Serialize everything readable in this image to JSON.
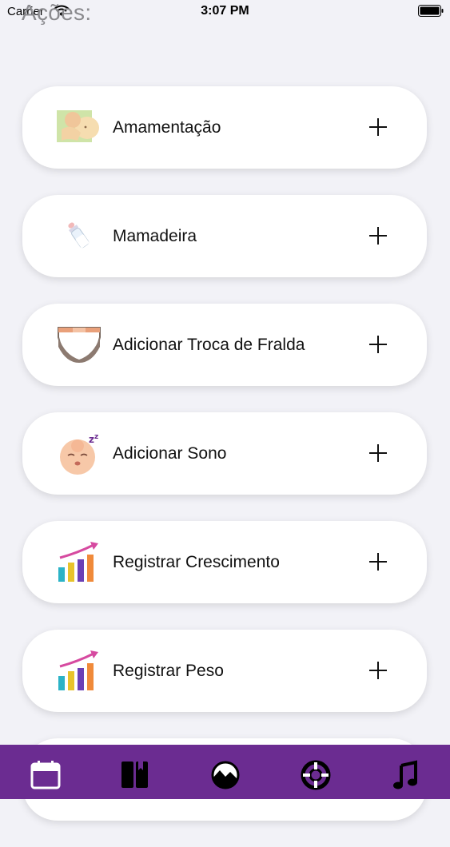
{
  "status_bar": {
    "carrier": "Carrier",
    "time": "3:07 PM"
  },
  "page": {
    "title": "Ações:"
  },
  "actions": [
    {
      "label": "Amamentação",
      "icon": "breastfeeding-icon"
    },
    {
      "label": "Mamadeira",
      "icon": "baby-bottle-icon"
    },
    {
      "label": "Adicionar Troca de Fralda",
      "icon": "diaper-icon"
    },
    {
      "label": "Adicionar Sono",
      "icon": "sleeping-baby-icon"
    },
    {
      "label": "Registrar Crescimento",
      "icon": "growth-chart-icon"
    },
    {
      "label": "Registrar Peso",
      "icon": "weight-chart-icon"
    }
  ],
  "tab_bar": {
    "background": "#6b2c91",
    "tabs": [
      "calendar-icon",
      "book-icon",
      "landscape-icon",
      "lifebuoy-icon",
      "music-note-icon"
    ]
  }
}
